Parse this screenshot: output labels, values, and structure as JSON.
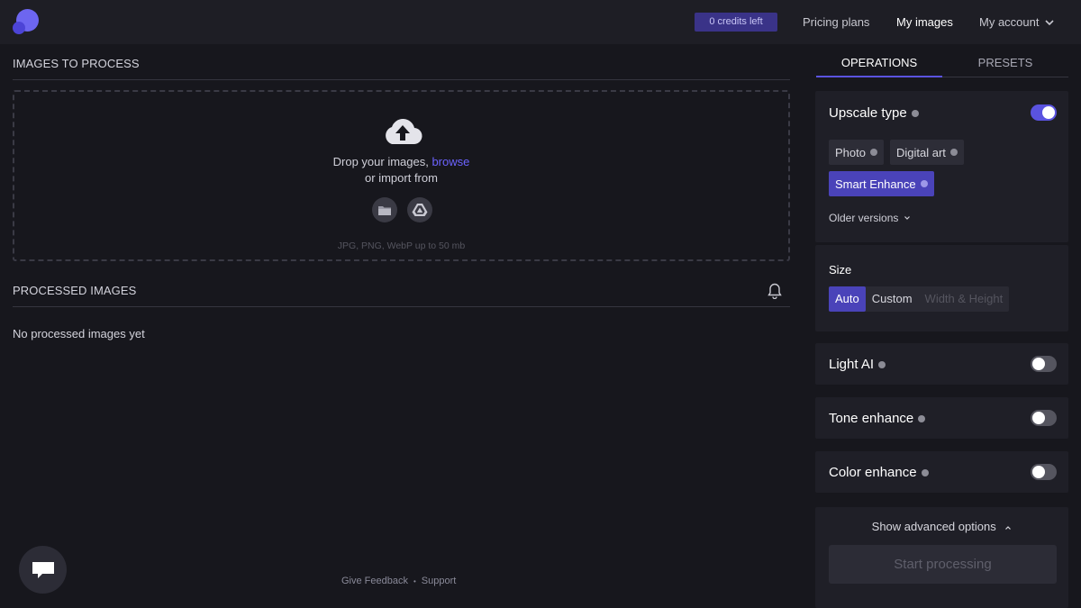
{
  "header": {
    "credits_label": "0 credits left",
    "nav": {
      "pricing": "Pricing plans",
      "my_images": "My images",
      "my_account": "My account"
    },
    "colors": {
      "brand": "#6d66f0",
      "credits_bg": "#3a3388"
    }
  },
  "left": {
    "to_process_title": "IMAGES TO PROCESS",
    "dropzone": {
      "line1_prefix": "Drop your images, ",
      "browse": "browse",
      "line2": "or import from",
      "note": "JPG, PNG, WebP up to 50 mb",
      "icons": [
        "cloud-upload-icon",
        "folder-icon",
        "google-drive-icon"
      ]
    },
    "processed_title": "PROCESSED IMAGES",
    "no_processed": "No processed images yet",
    "footer": {
      "feedback": "Give Feedback",
      "separator": "•",
      "support": "Support"
    }
  },
  "right": {
    "tabs": {
      "operations": "OPERATIONS",
      "presets": "PRESETS"
    },
    "upscale": {
      "title": "Upscale type",
      "enabled": true,
      "options": {
        "photo": "Photo",
        "digital_art": "Digital art",
        "smart_enhance": "Smart Enhance"
      },
      "selected": "Smart Enhance",
      "older_versions": "Older versions"
    },
    "size": {
      "label": "Size",
      "options": {
        "auto": "Auto",
        "custom": "Custom",
        "wh": "Width & Height"
      },
      "selected": "Auto"
    },
    "light_ai": {
      "title": "Light AI",
      "enabled": false
    },
    "tone": {
      "title": "Tone enhance",
      "enabled": false
    },
    "color": {
      "title": "Color enhance",
      "enabled": false
    },
    "advanced": "Show advanced options",
    "start": "Start processing",
    "accent": "#5a53e0"
  }
}
